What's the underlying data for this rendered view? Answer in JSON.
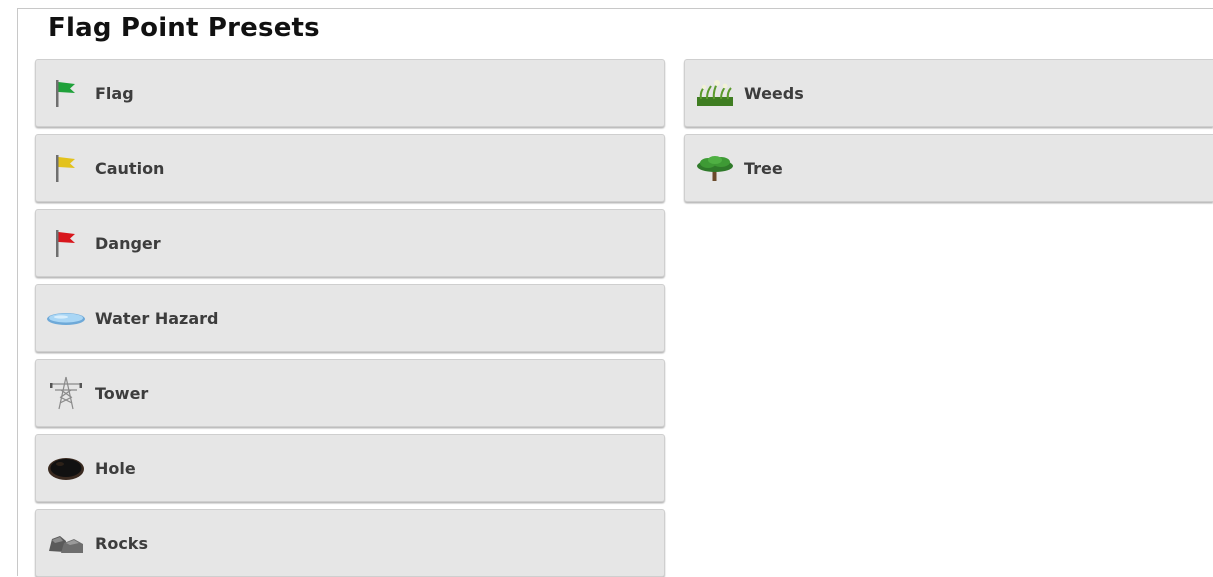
{
  "page": {
    "title": "Flag Point Presets"
  },
  "presets": {
    "left": [
      {
        "label": "Flag",
        "icon": "green-flag-icon",
        "color": "#1fa13a"
      },
      {
        "label": "Caution",
        "icon": "yellow-flag-icon",
        "color": "#e3c21c"
      },
      {
        "label": "Danger",
        "icon": "red-flag-icon",
        "color": "#d8161c"
      },
      {
        "label": "Water Hazard",
        "icon": "water-puddle-icon",
        "color": "#8fc6ef"
      },
      {
        "label": "Tower",
        "icon": "power-tower-icon",
        "color": "#8a8a8a"
      },
      {
        "label": "Hole",
        "icon": "hole-icon",
        "color": "#1a1a1a"
      },
      {
        "label": "Rocks",
        "icon": "rocks-icon",
        "color": "#5a5a5a"
      }
    ],
    "right": [
      {
        "label": "Weeds",
        "icon": "weeds-icon",
        "color": "#5b9a2c"
      },
      {
        "label": "Tree",
        "icon": "tree-icon",
        "color": "#2f7a2a"
      }
    ]
  }
}
